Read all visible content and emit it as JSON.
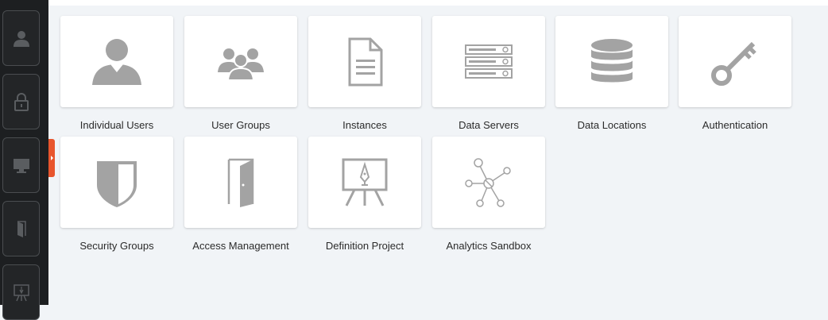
{
  "sidebar": {
    "items": [
      {
        "icon": "user-icon"
      },
      {
        "icon": "lock-icon"
      },
      {
        "icon": "monitor-icon"
      },
      {
        "icon": "door-icon"
      },
      {
        "icon": "presentation-icon"
      }
    ]
  },
  "tiles": [
    {
      "label": "Individual Users",
      "icon": "user-icon"
    },
    {
      "label": "User Groups",
      "icon": "user-group-icon"
    },
    {
      "label": "Instances",
      "icon": "document-icon"
    },
    {
      "label": "Data Servers",
      "icon": "server-icon"
    },
    {
      "label": "Data Locations",
      "icon": "database-icon"
    },
    {
      "label": "Authentication",
      "icon": "key-icon"
    },
    {
      "label": "Security Groups",
      "icon": "shield-icon"
    },
    {
      "label": "Access Management",
      "icon": "door-icon"
    },
    {
      "label": "Definition Project",
      "icon": "presentation-icon"
    },
    {
      "label": "Analytics Sandbox",
      "icon": "network-icon"
    }
  ],
  "colors": {
    "icon_gray": "#a3a3a3",
    "sidebar_bg": "#1d1f21",
    "accent": "#e8552d",
    "background": "#f1f4f7"
  }
}
